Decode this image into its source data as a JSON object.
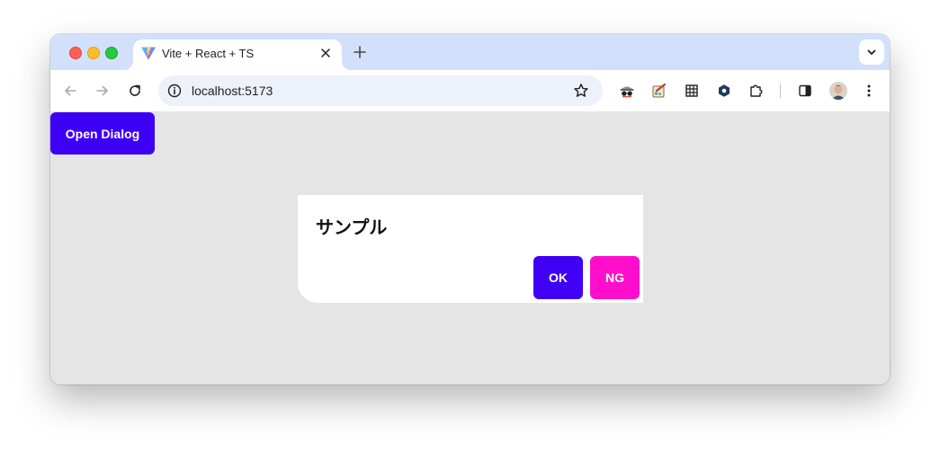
{
  "browser": {
    "tab": {
      "title": "Vite + React + TS",
      "favicon": "vite-logo-icon"
    },
    "toolbar": {
      "url": "localhost:5173",
      "extensions": [
        "incognito-extension-icon",
        "paint-extension-icon",
        "grid-extension-icon",
        "hex-extension-icon",
        "puzzle-extensions-icon"
      ]
    }
  },
  "page": {
    "open_dialog_label": "Open Dialog",
    "dialog": {
      "title": "サンプル",
      "ok_label": "OK",
      "ng_label": "NG"
    }
  },
  "colors": {
    "open_dialog_button": "#3d00f5",
    "ok_button": "#4000f5",
    "ng_button": "#ff0ecb",
    "page_background": "#e5e5e5",
    "tabstrip_background": "#d3e0fb"
  }
}
